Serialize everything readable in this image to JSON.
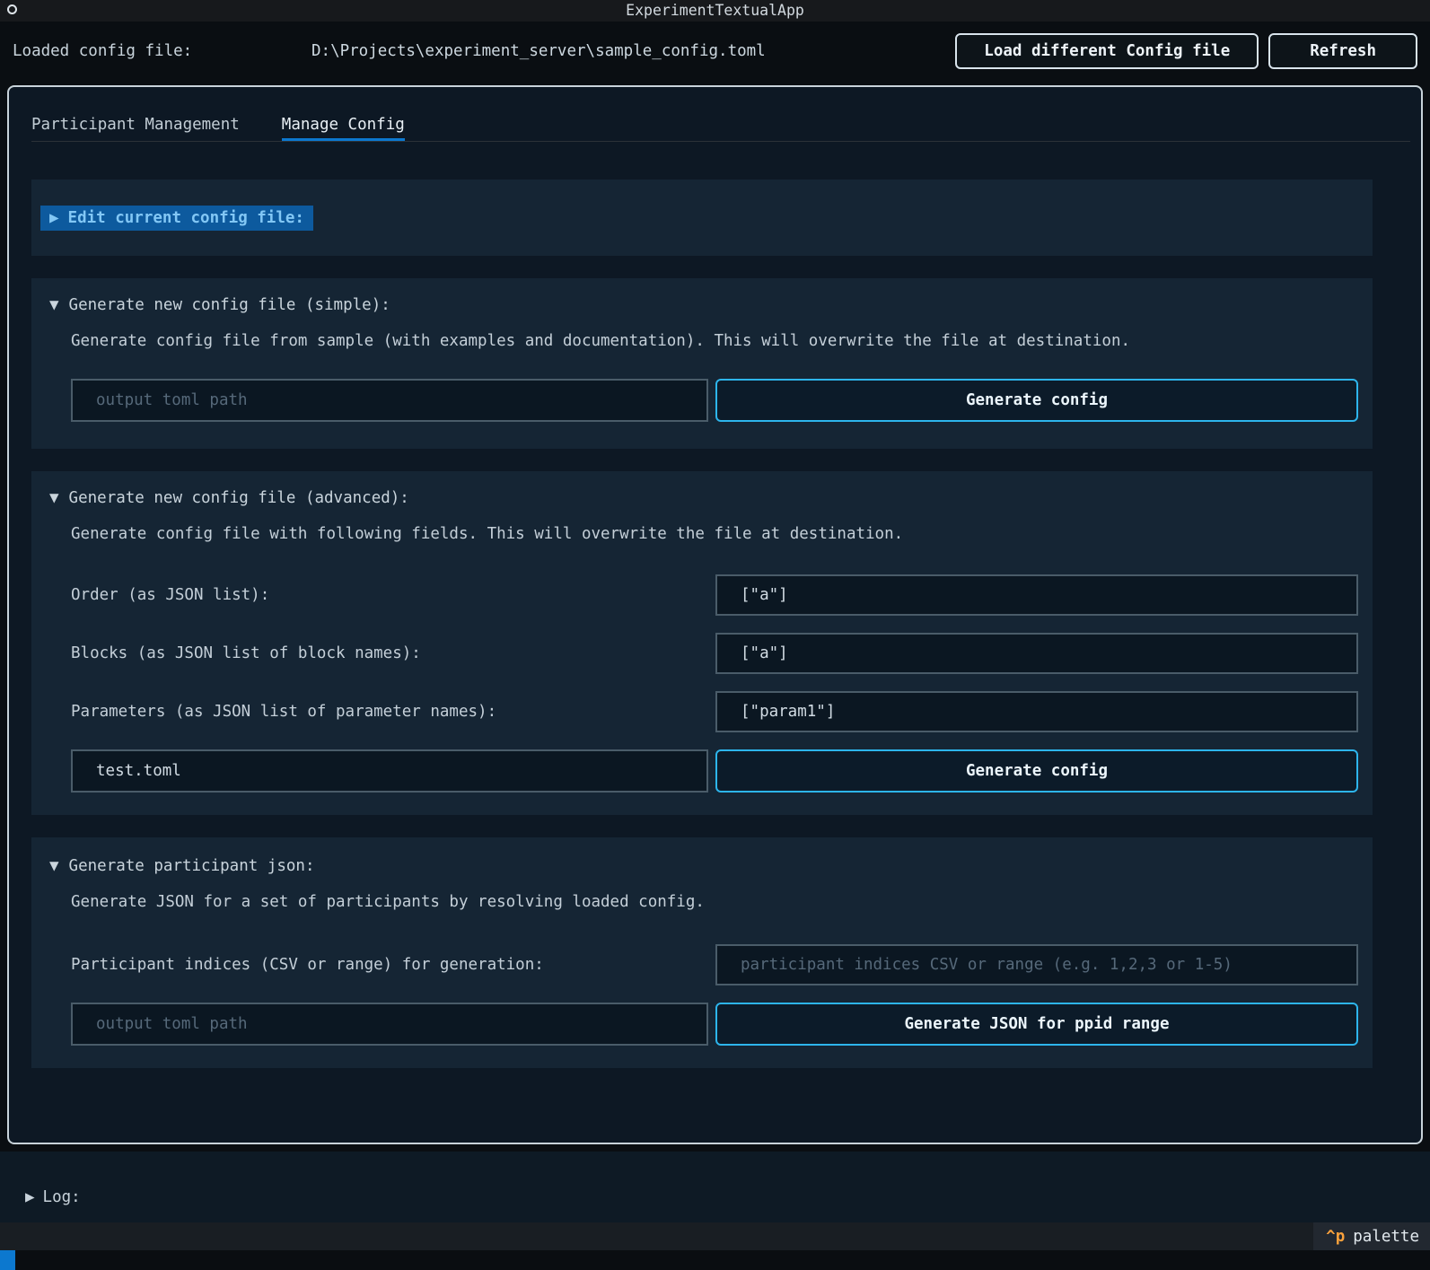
{
  "titlebar": {
    "title": "ExperimentTextualApp"
  },
  "header": {
    "label": "Loaded config file:",
    "path": "D:\\Projects\\experiment_server\\sample_config.toml",
    "load_button": "Load different Config file",
    "refresh_button": "Refresh"
  },
  "tabs": [
    {
      "label": "Participant Management"
    },
    {
      "label": "Manage Config"
    }
  ],
  "edit_collapsible": {
    "arrow": "▶",
    "label": "Edit current config file:"
  },
  "simple_section": {
    "arrow": "▼",
    "title": "Generate new config file (simple):",
    "description": "Generate config file from sample (with examples and documentation). This will overwrite the file at destination.",
    "output_placeholder": "output toml path",
    "generate_button": "Generate config"
  },
  "advanced_section": {
    "arrow": "▼",
    "title": "Generate new config file (advanced):",
    "description": "Generate config file with following fields. This will overwrite the file at destination.",
    "order_label": "Order (as JSON list):",
    "order_value": "[\"a\"]",
    "blocks_label": "Blocks (as JSON list of block names):",
    "blocks_value": "[\"a\"]",
    "params_label": "Parameters (as JSON list of parameter names):",
    "params_value": "[\"param1\"]",
    "output_value": "test.toml",
    "generate_button": "Generate config"
  },
  "participant_section": {
    "arrow": "▼",
    "title": "Generate participant json:",
    "description": "Generate JSON for a set of participants by resolving loaded config.",
    "indices_label": "Participant indices (CSV or range) for generation:",
    "indices_placeholder": "participant indices CSV or range (e.g. 1,2,3 or 1-5)",
    "output_placeholder": "output toml path",
    "generate_button": "Generate JSON for ppid range"
  },
  "log_collapsible": {
    "arrow": "▶",
    "label": "Log:"
  },
  "footer": {
    "key": "^p",
    "label": "palette"
  },
  "colors": {
    "accent": "#0c78cf",
    "cyan_button_border": "#2db5ec",
    "panel_border": "#c8d3da",
    "section_bg": "#152534",
    "chip_bg": "#0d5a9e",
    "chip_text": "#82c7f5",
    "footer_key": "#f9a13c"
  }
}
